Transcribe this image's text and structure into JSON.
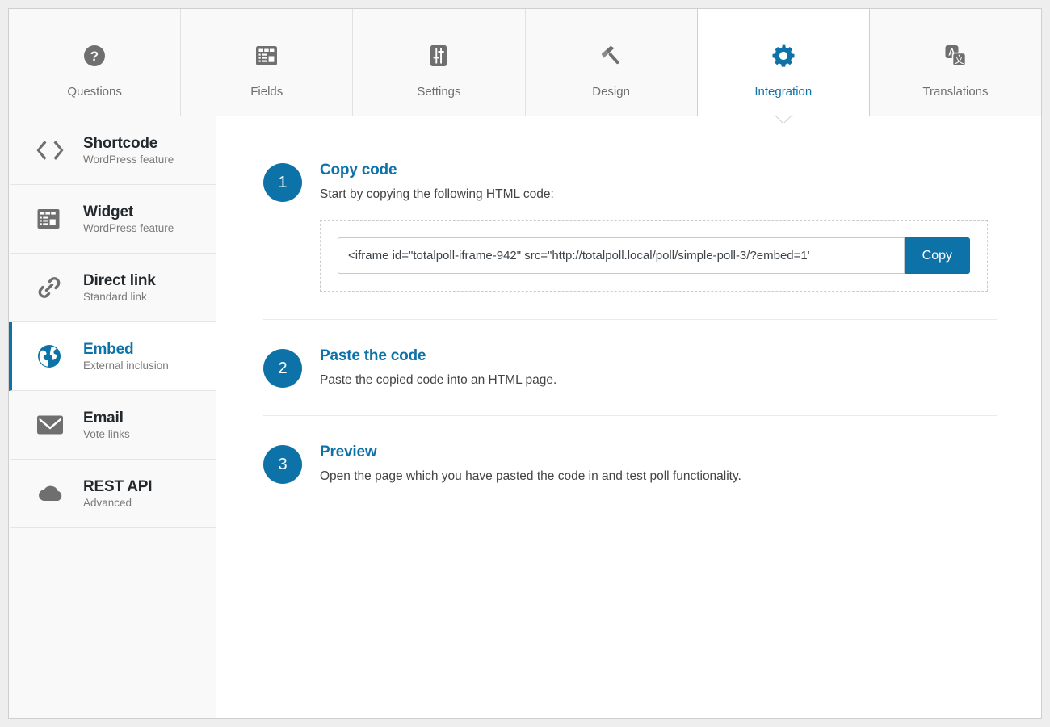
{
  "tabs": [
    {
      "label": "Questions",
      "icon": "question-mark-circle-icon",
      "active": false
    },
    {
      "label": "Fields",
      "icon": "form-fields-icon",
      "active": false
    },
    {
      "label": "Settings",
      "icon": "sliders-icon",
      "active": false
    },
    {
      "label": "Design",
      "icon": "hammer-icon",
      "active": false
    },
    {
      "label": "Integration",
      "icon": "gear-icon",
      "active": true
    },
    {
      "label": "Translations",
      "icon": "translate-icon",
      "active": false
    }
  ],
  "sidebar": {
    "items": [
      {
        "title": "Shortcode",
        "subtitle": "WordPress feature",
        "icon": "code-brackets-icon",
        "active": false
      },
      {
        "title": "Widget",
        "subtitle": "WordPress feature",
        "icon": "widget-grid-icon",
        "active": false
      },
      {
        "title": "Direct link",
        "subtitle": "Standard link",
        "icon": "chain-link-icon",
        "active": false
      },
      {
        "title": "Embed",
        "subtitle": "External inclusion",
        "icon": "globe-icon",
        "active": true
      },
      {
        "title": "Email",
        "subtitle": "Vote links",
        "icon": "envelope-icon",
        "active": false
      },
      {
        "title": "REST API",
        "subtitle": "Advanced",
        "icon": "cloud-icon",
        "active": false
      }
    ]
  },
  "steps": [
    {
      "number": "1",
      "title": "Copy code",
      "description": "Start by copying the following HTML code:"
    },
    {
      "number": "2",
      "title": "Paste the code",
      "description": "Paste the copied code into an HTML page."
    },
    {
      "number": "3",
      "title": "Preview",
      "description": "Open the page which you have pasted the code in and test poll functionality."
    }
  ],
  "code_box": {
    "value": "<iframe id=\"totalpoll-iframe-942\" src=\"http://totalpoll.local/poll/simple-poll-3/?embed=1'",
    "copy_label": "Copy"
  },
  "colors": {
    "accent": "#0d72a8",
    "icon_gray": "#6f6f6f",
    "title_dark": "#23282d",
    "page_bg": "#eeeeee",
    "panel_bg": "#f9f9f9"
  }
}
